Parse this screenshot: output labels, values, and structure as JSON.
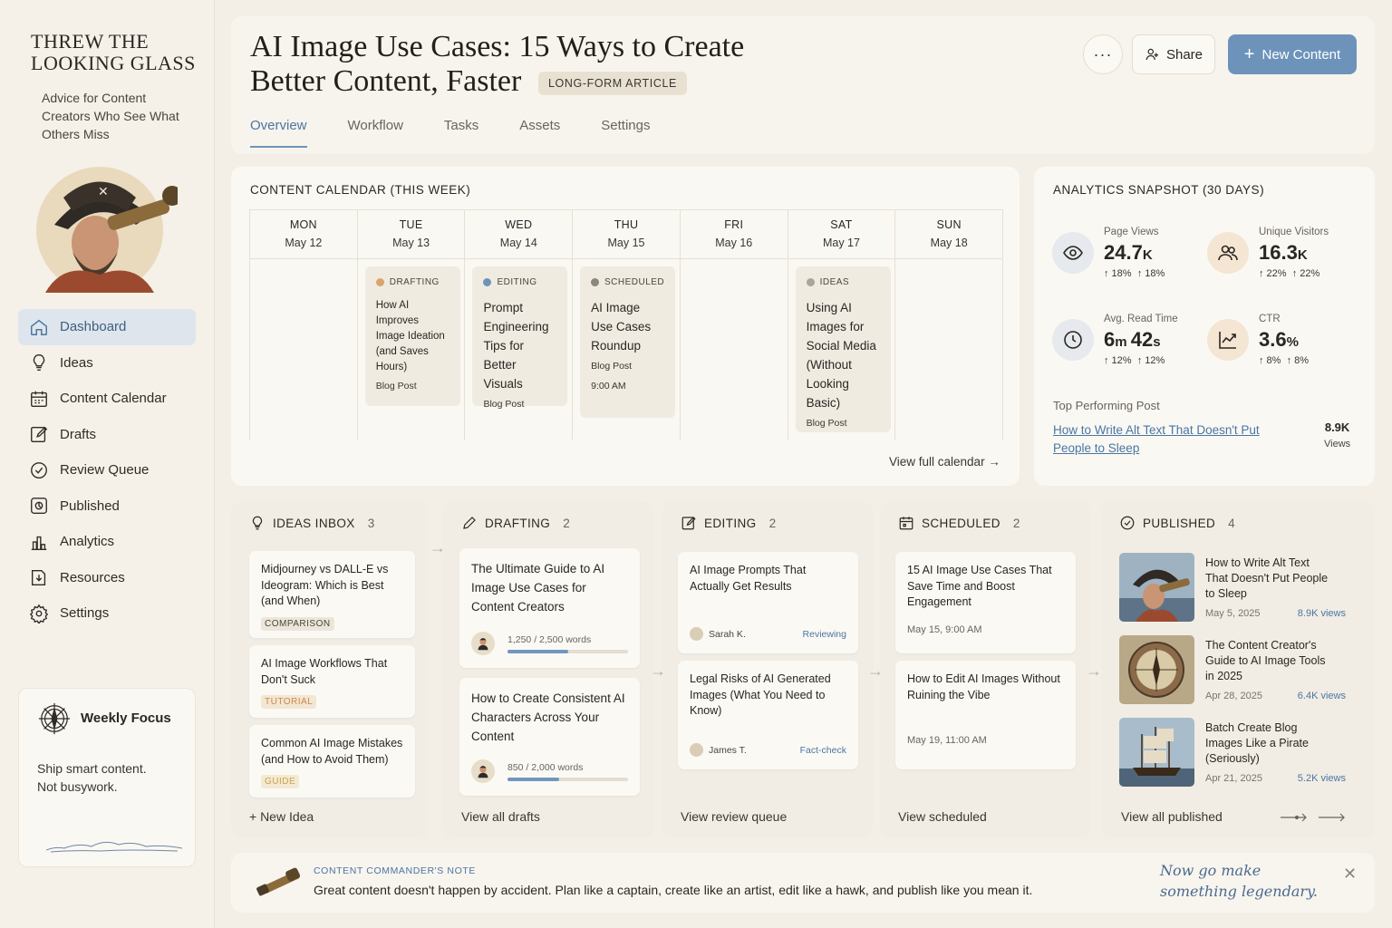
{
  "brand": {
    "title": "THREW THE LOOKING GLASS",
    "tagline": "Advice for Content Creators Who See What Others Miss"
  },
  "sidebar": {
    "items": [
      {
        "label": "Dashboard",
        "icon": "home-icon",
        "active": true
      },
      {
        "label": "Ideas",
        "icon": "lightbulb-icon"
      },
      {
        "label": "Content Calendar",
        "icon": "calendar-icon"
      },
      {
        "label": "Drafts",
        "icon": "pencil-icon"
      },
      {
        "label": "Review Queue",
        "icon": "check-circle-icon"
      },
      {
        "label": "Published",
        "icon": "published-icon"
      },
      {
        "label": "Analytics",
        "icon": "bar-chart-icon"
      },
      {
        "label": "Resources",
        "icon": "folder-icon"
      },
      {
        "label": "Settings",
        "icon": "gear-icon"
      }
    ],
    "weekly_focus": {
      "title": "Weekly Focus",
      "line1": "Ship smart content.",
      "line2": "Not busywork."
    }
  },
  "header": {
    "title": "AI Image Use Cases: 15 Ways to Create Better Content, Faster",
    "badge": "LONG-FORM ARTICLE",
    "more_label": "···",
    "share_label": "Share",
    "new_content_label": "New Content",
    "tabs": [
      "Overview",
      "Workflow",
      "Tasks",
      "Assets",
      "Settings"
    ],
    "active_tab": "Overview"
  },
  "calendar": {
    "title": "CONTENT CALENDAR (THIS WEEK)",
    "days": [
      {
        "day": "MON",
        "date": "May 12"
      },
      {
        "day": "TUE",
        "date": "May 13"
      },
      {
        "day": "WED",
        "date": "May 14"
      },
      {
        "day": "THU",
        "date": "May 15"
      },
      {
        "day": "FRI",
        "date": "May 16"
      },
      {
        "day": "SAT",
        "date": "May 17"
      },
      {
        "day": "SUN",
        "date": "May 18"
      }
    ],
    "events": {
      "tue": {
        "status": "DRAFTING",
        "color": "#d9a46d",
        "title": "How AI Improves Image Ideation (and Saves Hours)",
        "type": "Blog Post"
      },
      "wed": {
        "status": "EDITING",
        "color": "#6d93bb",
        "title": "Prompt Engineering Tips for Better Visuals",
        "type": "Blog Post"
      },
      "thu": {
        "status": "SCHEDULED",
        "color": "#8a8680",
        "title": "AI Image Use Cases Roundup",
        "type": "Blog Post",
        "time": "9:00 AM"
      },
      "sat": {
        "status": "IDEAS",
        "color": "#a8a49e",
        "title": "Using AI Images for Social Media (Without Looking Basic)",
        "type": "Blog Post"
      }
    },
    "view_link": "View full calendar →"
  },
  "analytics": {
    "title": "ANALYTICS SNAPSHOT (30 DAYS)",
    "metrics": [
      {
        "label": "Page Views",
        "value": "24.7",
        "unit": "K",
        "change": "↑ 18%",
        "icon": "eye-icon"
      },
      {
        "label": "Unique Visitors",
        "value": "16.3",
        "unit": "K",
        "change": "↑ 22%",
        "icon": "users-icon"
      },
      {
        "label": "Avg. Read Time",
        "value_m": "6",
        "value_s": "42",
        "change": "↑ 12%",
        "icon": "clock-icon"
      },
      {
        "label": "CTR",
        "value": "3.6",
        "unit": "%",
        "change": "↑ 8%",
        "icon": "trend-icon"
      }
    ],
    "top_label": "Top Performing Post",
    "top_post": "How to Write Alt Text That Doesn't Put People to Sleep",
    "top_views": "8.9K",
    "top_views_label": "Views"
  },
  "kanban": {
    "ideas": {
      "title": "IDEAS INBOX",
      "count": "3",
      "cards": [
        {
          "title": "Midjourney vs DALL-E vs Ideogram: Which is Best (and When)",
          "tag": "COMPARISON"
        },
        {
          "title": "AI Image Workflows That Don't Suck",
          "tag": "TUTORIAL"
        },
        {
          "title": "Common AI Image Mistakes (and How to Avoid Them)",
          "tag": "GUIDE"
        }
      ],
      "footer": "+ New Idea"
    },
    "drafting": {
      "title": "DRAFTING",
      "count": "2",
      "cards": [
        {
          "title": "The Ultimate Guide to AI Image Use Cases for Content Creators",
          "words": "1,250 / 2,500 words",
          "progress": 0.5
        },
        {
          "title": "How to Create Consistent AI Characters Across Your Content",
          "words": "850 / 2,000 words",
          "progress": 0.425
        }
      ],
      "footer": "View all drafts"
    },
    "editing": {
      "title": "EDITING",
      "count": "2",
      "cards": [
        {
          "title": "AI Image Prompts That Actually Get Results",
          "who": "Sarah K.",
          "state": "Reviewing"
        },
        {
          "title": "Legal Risks of AI Generated Images (What You Need to Know)",
          "who": "James T.",
          "state": "Fact-check"
        }
      ],
      "footer": "View review queue"
    },
    "scheduled": {
      "title": "SCHEDULED",
      "count": "2",
      "cards": [
        {
          "title": "15 AI Image Use Cases That Save Time and Boost Engagement",
          "when": "May 15, 9:00 AM"
        },
        {
          "title": "How to Edit AI Images Without Ruining the Vibe",
          "when": "May 19, 11:00 AM"
        }
      ],
      "footer": "View scheduled"
    },
    "published": {
      "title": "PUBLISHED",
      "count": "4",
      "items": [
        {
          "title": "How to Write Alt Text That Doesn't Put People to Sleep",
          "date": "May 5, 2025",
          "views": "8.9K views"
        },
        {
          "title": "The Content Creator's Guide to AI Image Tools in 2025",
          "date": "Apr 28, 2025",
          "views": "6.4K views"
        },
        {
          "title": "Batch Create Blog Images Like a Pirate (Seriously)",
          "date": "Apr 21, 2025",
          "views": "5.2K views"
        }
      ],
      "footer": "View all published"
    }
  },
  "note": {
    "label": "CONTENT COMMANDER'S NOTE",
    "text": "Great content doesn't happen by accident. Plan like a captain, create like an artist, edit like a hawk, and publish like you mean it.",
    "sign": "Now go make something legendary.",
    "close": "✕"
  },
  "colors": {
    "accent": "#6d93bb",
    "link": "#4a76a3",
    "background": "#f3efe6"
  }
}
